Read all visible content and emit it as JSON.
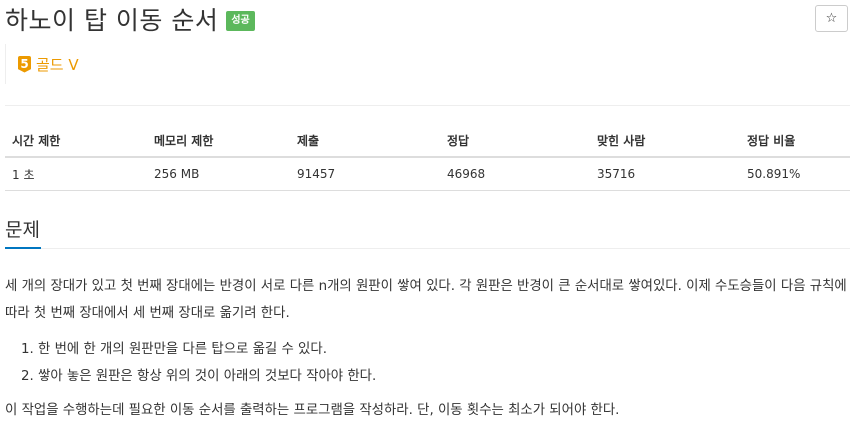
{
  "problem": {
    "title": "하노이 탑 이동 순서",
    "status_badge": "성공",
    "star_symbol": "☆",
    "tier": {
      "level": "5",
      "label": "골드 V",
      "color": "#ec9a00"
    }
  },
  "info_table": {
    "headers": [
      "시간 제한",
      "메모리 제한",
      "제출",
      "정답",
      "맞힌 사람",
      "정답 비율"
    ],
    "row": [
      "1 초",
      "256 MB",
      "91457",
      "46968",
      "35716",
      "50.891%"
    ]
  },
  "section": {
    "title": "문제",
    "paragraph1": "세 개의 장대가 있고 첫 번째 장대에는 반경이 서로 다른 n개의 원판이 쌓여 있다. 각 원판은 반경이 큰 순서대로 쌓여있다. 이제 수도승들이 다음 규칙에 따라 첫 번째 장대에서 세 번째 장대로 옮기려 한다.",
    "rules": [
      "한 번에 한 개의 원판만을 다른 탑으로 옮길 수 있다.",
      "쌓아 놓은 원판은 항상 위의 것이 아래의 것보다 작아야 한다."
    ],
    "paragraph2": "이 작업을 수행하는데 필요한 이동 순서를 출력하는 프로그램을 작성하라. 단, 이동 횟수는 최소가 되어야 한다."
  },
  "colors": {
    "success": "#5cb85c",
    "accent": "#0076c0",
    "gold": "#ec9a00"
  }
}
